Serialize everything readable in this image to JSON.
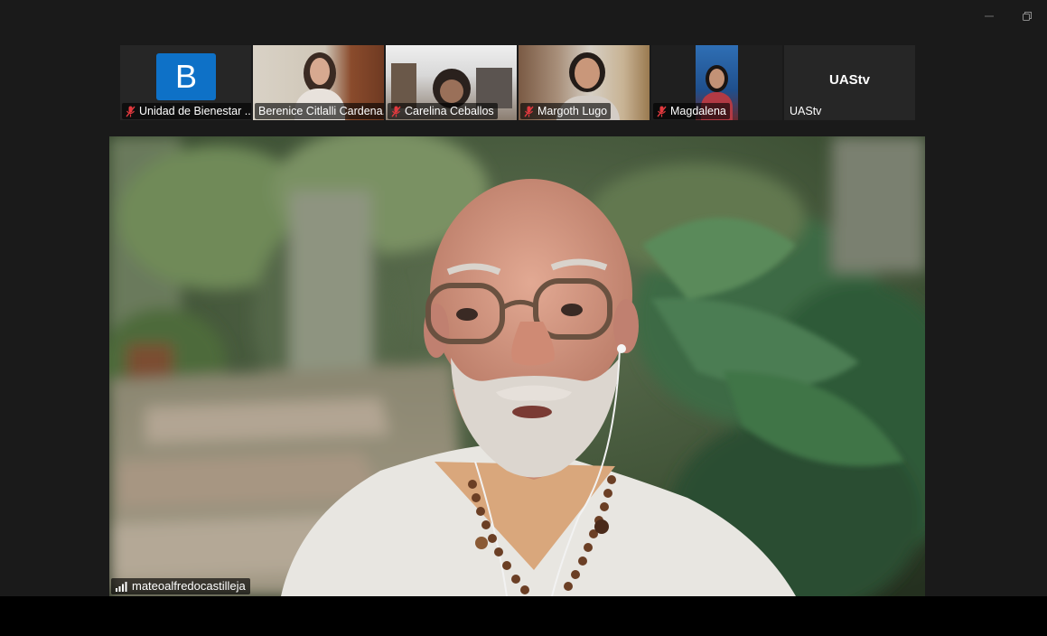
{
  "window": {
    "controls": [
      {
        "icon": "minimize-icon"
      },
      {
        "icon": "restore-icon"
      }
    ]
  },
  "participants": [
    {
      "name": "Unidad de Bienestar ...",
      "muted": true,
      "display": "avatar",
      "avatar_letter": "B",
      "avatar_color": "#0e71c7"
    },
    {
      "name": "Berenice Citlalli Cardena...",
      "muted": false,
      "display": "video"
    },
    {
      "name": "Carelina Ceballos",
      "muted": true,
      "display": "video"
    },
    {
      "name": "Margoth Lugo",
      "muted": true,
      "display": "video"
    },
    {
      "name": "Magdalena",
      "muted": true,
      "display": "video"
    },
    {
      "name": "UAStv",
      "muted": false,
      "display": "name",
      "tile_title": "UAStv"
    }
  ],
  "active_speaker": {
    "name": "mateoalfredocastilleja",
    "icon": "signal-bars-icon"
  },
  "colors": {
    "background": "#1a1a1a",
    "tile": "#262626",
    "mute_red": "#e0393e",
    "avatar_blue": "#0e71c7"
  }
}
